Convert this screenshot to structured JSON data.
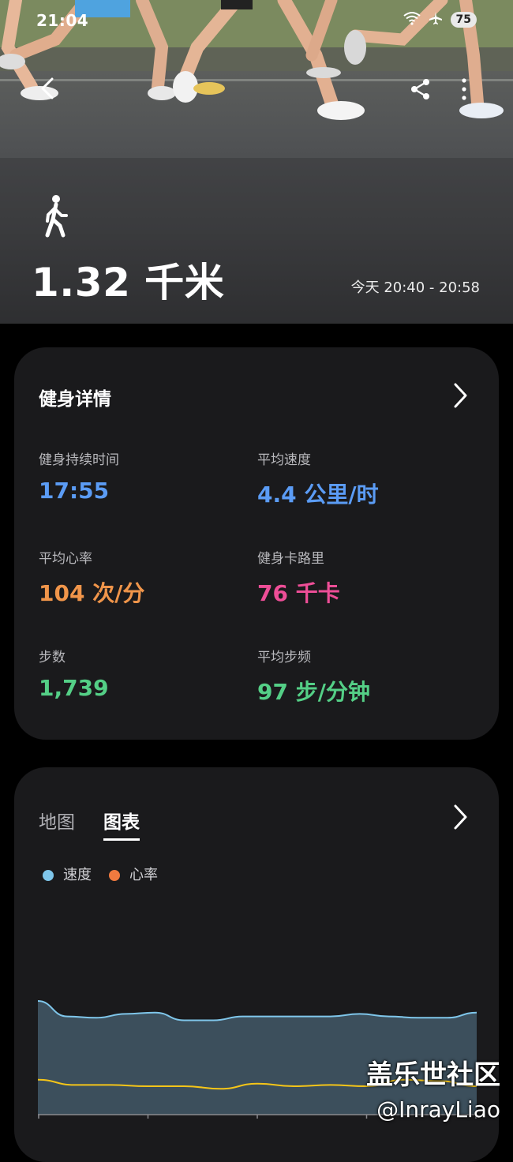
{
  "status_bar": {
    "time": "21:04",
    "battery": "75"
  },
  "hero": {
    "distance": "1.32 千米",
    "time_range": "今天 20:40 - 20:58"
  },
  "details": {
    "title": "健身详情",
    "metrics": [
      {
        "label": "健身持续时间",
        "value": "17:55",
        "color": "#5b9cf5"
      },
      {
        "label": "平均速度",
        "value": "4.4 公里/时",
        "color": "#5b9cf5"
      },
      {
        "label": "平均心率",
        "value": "104 次/分",
        "color": "#f0954a"
      },
      {
        "label": "健身卡路里",
        "value": "76 千卡",
        "color": "#ee4e97"
      },
      {
        "label": "步数",
        "value": "1,739",
        "color": "#54cf86"
      },
      {
        "label": "平均步频",
        "value": "97 步/分钟",
        "color": "#54cf86"
      }
    ]
  },
  "chart_card": {
    "tabs": [
      "地图",
      "图表"
    ],
    "active_tab": "图表",
    "legend": [
      {
        "name": "速度",
        "color": "#7fc6ea"
      },
      {
        "name": "心率",
        "color": "#f07a3f"
      }
    ]
  },
  "chart_data": {
    "type": "area",
    "series": [
      {
        "name": "速度",
        "color": "#7fc6ea",
        "values": [
          88,
          76,
          75,
          78,
          79,
          73,
          73,
          76,
          76,
          76,
          76,
          78,
          76,
          75,
          75,
          79
        ]
      },
      {
        "name": "心率",
        "color": "#f5c518",
        "values": [
          27,
          23,
          23,
          22,
          22,
          20,
          24,
          22,
          23,
          22,
          27,
          26,
          22
        ]
      }
    ],
    "ylim": [
      0,
      110
    ],
    "grid": false
  },
  "watermark": {
    "line1": "盖乐世社区",
    "line2": "@InrayLiao"
  }
}
